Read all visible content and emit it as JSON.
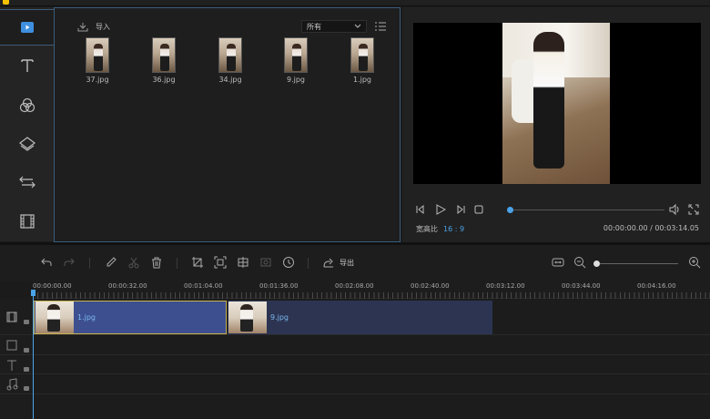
{
  "rail": {
    "items": [
      {
        "icon": "media-icon",
        "active": true
      },
      {
        "icon": "text-icon"
      },
      {
        "icon": "filter-icon"
      },
      {
        "icon": "overlay-icon"
      },
      {
        "icon": "transition-icon"
      },
      {
        "icon": "film-icon"
      }
    ]
  },
  "media": {
    "import_label": "导入",
    "filter_value": "所有",
    "files": [
      {
        "name": "37.jpg"
      },
      {
        "name": "36.jpg"
      },
      {
        "name": "34.jpg"
      },
      {
        "name": "9.jpg"
      },
      {
        "name": "1.jpg"
      }
    ]
  },
  "preview": {
    "ratio_label": "宽高比",
    "ratio_value": "16 : 9",
    "timecode": "00:00:00.00 / 00:03:14.05",
    "progress": 0.0
  },
  "toolbar": {
    "export_label": "导出"
  },
  "ruler": {
    "labels": [
      "00:00:00.00",
      "00:00:32.00",
      "00:01:04.00",
      "00:01:36.00",
      "00:02:08.00",
      "00:02:40.00",
      "00:03:12.00",
      "00:03:44.00",
      "00:04:16.00"
    ]
  },
  "timeline": {
    "clips": [
      {
        "label": "1.jpg",
        "selected": true
      },
      {
        "label": "9.jpg",
        "selected": false
      }
    ]
  },
  "colors": {
    "accent": "#4aa3e8",
    "clip_selected": "#3d4f8f",
    "clip_normal": "#2c3452",
    "panel_border": "#3b5c79"
  }
}
